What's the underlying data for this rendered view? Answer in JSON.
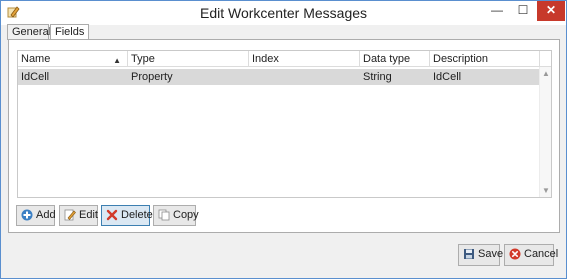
{
  "window": {
    "title": "Edit Workcenter Messages",
    "controls": {
      "minimize": "—",
      "maximize": "☐",
      "close": "✕"
    }
  },
  "tabs": [
    {
      "label": "General",
      "selected": false
    },
    {
      "label": "Fields",
      "selected": true
    }
  ],
  "grid": {
    "columns": [
      "Name",
      "Type",
      "Index",
      "Data type",
      "Description"
    ],
    "sort_column": "Name",
    "sort_direction": "ascending",
    "rows": [
      {
        "name": "IdCell",
        "type": "Property",
        "index": "",
        "data_type": "String",
        "description": "IdCell"
      }
    ]
  },
  "actions": {
    "add": "Add",
    "edit": "Edit",
    "delete": "Delete",
    "copy": "Copy"
  },
  "footer": {
    "save": "Save",
    "cancel": "Cancel"
  },
  "colors": {
    "close_button": "#c7392b",
    "selected_row": "#d9d9d9",
    "focus_border": "#3c7fb1"
  }
}
